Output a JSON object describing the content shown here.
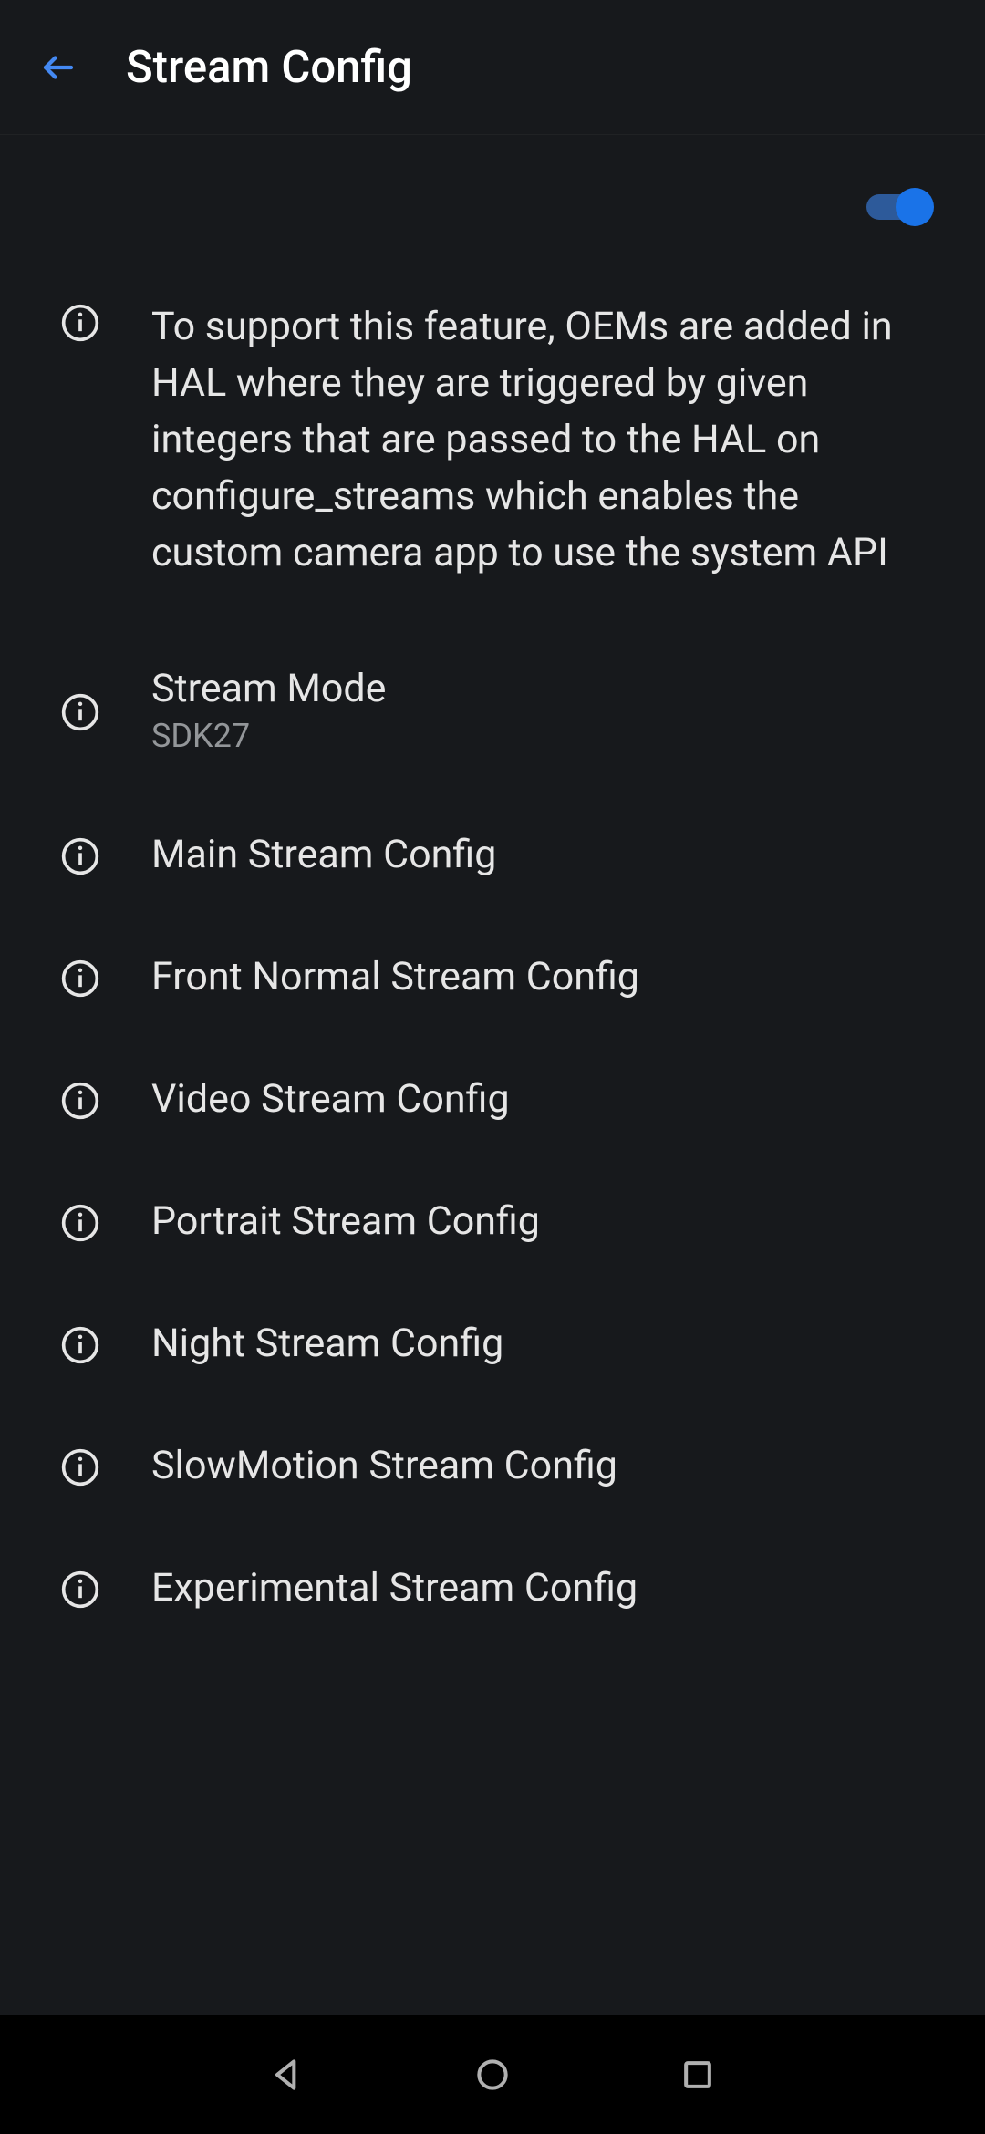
{
  "header": {
    "title": "Stream Config"
  },
  "toggle": {
    "enabled": true
  },
  "description": "To support this feature, OEMs are added in HAL where they are triggered by given integers that are passed to the HAL on configure_streams which enables the custom camera app to use the system API",
  "items": [
    {
      "title": "Stream Mode",
      "sub": "SDK27"
    },
    {
      "title": "Main Stream Config",
      "sub": ""
    },
    {
      "title": "Front Normal Stream Config",
      "sub": ""
    },
    {
      "title": "Video Stream Config",
      "sub": ""
    },
    {
      "title": "Portrait Stream Config",
      "sub": ""
    },
    {
      "title": "Night Stream Config",
      "sub": ""
    },
    {
      "title": "SlowMotion Stream Config",
      "sub": ""
    },
    {
      "title": "Experimental Stream Config",
      "sub": ""
    }
  ]
}
